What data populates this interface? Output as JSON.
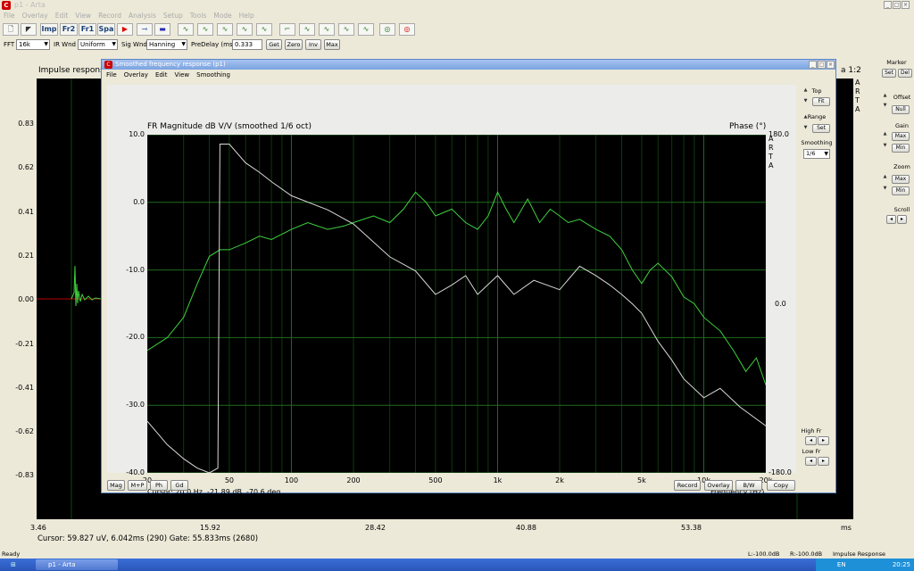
{
  "app": {
    "title": "p1 - Arta",
    "menu": [
      "File",
      "Overlay",
      "Edit",
      "View",
      "Record",
      "Analysis",
      "Setup",
      "Tools",
      "Mode",
      "Help"
    ],
    "toolbar": {
      "modes": [
        "Imp",
        "Fr2",
        "Fr1",
        "Spa"
      ]
    },
    "settings": {
      "fft_label": "FFT",
      "fft_value": "16k",
      "ir_wnd_label": "IR Wnd",
      "ir_wnd_value": "Uniform",
      "sig_wnd_label": "Sig Wnd",
      "sig_wnd_value": "Hanning",
      "predelay_label": "PreDelay (ms)",
      "predelay_value": "0.333",
      "get": "Get",
      "zero": "Zero",
      "inv": "Inv",
      "max": "Max"
    }
  },
  "impulse": {
    "title": "Impulse respons",
    "title_right": "a 1:2",
    "yticks": [
      "0.83",
      "0.62",
      "0.41",
      "0.21",
      "0.00",
      "-0.21",
      "-0.41",
      "-0.62",
      "-0.83"
    ],
    "xticks": [
      "3.46",
      "15.92",
      "28.42",
      "40.88",
      "53.38"
    ],
    "xunit": "ms",
    "cursor": "Cursor: 59.827 uV, 6.042ms (290)  Gate: 55.833ms (2680)"
  },
  "right_panel": {
    "marker": "Marker",
    "set": "Set",
    "del": "Del",
    "offset": "Offset",
    "null": "Null",
    "gain": "Gain",
    "max": "Max",
    "min": "Min",
    "zoom": "Zoom",
    "zmax": "Max",
    "zmin": "Min",
    "scroll": "Scroll"
  },
  "dialog": {
    "title": "Smoothed frequency response (p1)",
    "menu": [
      "File",
      "Overlay",
      "Edit",
      "View",
      "Smoothing"
    ],
    "plot_title": "FR Magnitude dB V/V (smoothed 1/6 oct)",
    "phase_title": "Phase (°)",
    "arta": "ARTA",
    "cursor": "Cursor: 20.0 Hz, -21.89 dB, -70.6 deg",
    "xlabel": "Frequency (Hz)",
    "side": {
      "top": "Top",
      "fit": "Fit",
      "range": "Range",
      "set": "Set",
      "smoothing": "Smoothing",
      "smoothing_value": "1/6",
      "high_fr": "High Fr",
      "low_fr": "Low Fr"
    },
    "buttons_left": [
      "Mag",
      "M+P",
      "Ph",
      "Gd"
    ],
    "buttons_right": [
      "Record",
      "Overlay",
      "B/W",
      "Copy"
    ]
  },
  "chart_data": {
    "type": "line",
    "title": "FR Magnitude dB V/V (smoothed 1/6 oct)",
    "xlabel": "Frequency (Hz)",
    "ylabel": "",
    "y2label": "Phase (°)",
    "xscale": "log",
    "xlim": [
      20,
      20000
    ],
    "ylim": [
      -40,
      10
    ],
    "y2lim": [
      -180,
      180
    ],
    "xticks": [
      "20",
      "50",
      "100",
      "200",
      "500",
      "1k",
      "2k",
      "5k",
      "10k",
      "20k"
    ],
    "yticks": [
      "10.0",
      "0.0",
      "-10.0",
      "-20.0",
      "-30.0",
      "-40.0"
    ],
    "y2ticks": [
      "180.0",
      "0.0",
      "-180.0"
    ],
    "series": [
      {
        "axis": "left",
        "color": "#3ed13e",
        "x": [
          20,
          25,
          30,
          35,
          40,
          45,
          50,
          60,
          70,
          80,
          100,
          120,
          150,
          180,
          200,
          250,
          300,
          350,
          400,
          450,
          500,
          600,
          700,
          800,
          900,
          1000,
          1100,
          1200,
          1400,
          1600,
          1800,
          2000,
          2200,
          2500,
          3000,
          3500,
          4000,
          4500,
          5000,
          5500,
          6000,
          7000,
          8000,
          9000,
          10000,
          12000,
          14000,
          16000,
          18000,
          20000
        ],
        "y": [
          -21.9,
          -20,
          -17,
          -12,
          -8,
          -7,
          -7,
          -6,
          -5,
          -5.5,
          -4,
          -3,
          -4,
          -3.5,
          -3,
          -2,
          -3,
          -1,
          1.5,
          0,
          -2,
          -1,
          -3,
          -4,
          -2,
          1.5,
          -1,
          -3,
          0.5,
          -3,
          -1,
          -2,
          -3,
          -2.5,
          -4,
          -5,
          -7,
          -10,
          -12,
          -10,
          -9,
          -11,
          -14,
          -15,
          -17,
          -19,
          -22,
          -25,
          -23,
          -27
        ]
      },
      {
        "axis": "right",
        "color": "#d8d8d8",
        "x": [
          20,
          25,
          30,
          35,
          40,
          44,
          45,
          50,
          60,
          70,
          80,
          100,
          150,
          200,
          300,
          400,
          500,
          600,
          700,
          800,
          1000,
          1200,
          1500,
          2000,
          2500,
          3000,
          3500,
          4000,
          4500,
          5000,
          6000,
          7000,
          8000,
          10000,
          12000,
          15000,
          20000
        ],
        "y": [
          -125,
          -150,
          -165,
          -175,
          -180,
          -175,
          170,
          170,
          150,
          140,
          130,
          115,
          100,
          85,
          50,
          35,
          10,
          20,
          30,
          10,
          30,
          10,
          25,
          15,
          40,
          30,
          20,
          10,
          0,
          -10,
          -40,
          -60,
          -80,
          -100,
          -90,
          -110,
          -130
        ]
      }
    ]
  },
  "status": {
    "left": "Ready",
    "l": "L:-100.0dB",
    "r": "R:-100.0dB",
    "mode": "Impulse Response"
  },
  "taskbar": {
    "item": "p1 - Arta",
    "lang": "EN",
    "time": "20:25"
  }
}
